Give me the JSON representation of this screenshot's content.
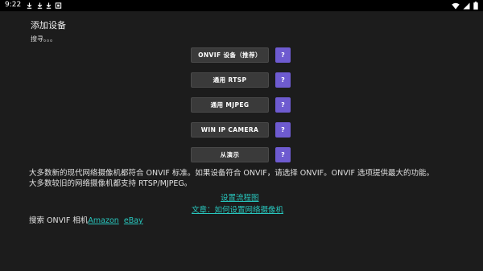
{
  "status_bar": {
    "time": "9:22",
    "notification_icons": [
      "download-icon",
      "download-icon",
      "download-icon",
      "app-icon"
    ],
    "right_icons": [
      "wifi-icon",
      "signal-icon",
      "battery-icon"
    ]
  },
  "header": {
    "title": "添加设备",
    "status_text": "搜寻。。。"
  },
  "buttons": [
    {
      "label": "ONVIF 设备（推荐）",
      "help": "?"
    },
    {
      "label": "通用 RTSP",
      "help": "?"
    },
    {
      "label": "通用 MJPEG",
      "help": "?"
    },
    {
      "label": "WIN IP CAMERA",
      "help": "?"
    },
    {
      "label": "从演示",
      "help": "?"
    }
  ],
  "description": {
    "line1": "大多数新的现代网络摄像机都符合 ONVIF 标准。如果设备符合 ONVIF，请选择 ONVIF。ONVIF 选项提供最大的功能。",
    "line2": "大多数较旧的网络摄像机都支持 RTSP/MJPEG。"
  },
  "links": {
    "flowchart": "设置流程图",
    "article": "文章：如何设置网络摄像机"
  },
  "search": {
    "prefix": "搜索 ONVIF 相机",
    "amazon": "Amazon",
    "ebay": "eBay"
  },
  "colors": {
    "background": "#1c1c1c",
    "button": "#3a3a3a",
    "help_button": "#6e5bd0",
    "link": "#28c6bd"
  }
}
